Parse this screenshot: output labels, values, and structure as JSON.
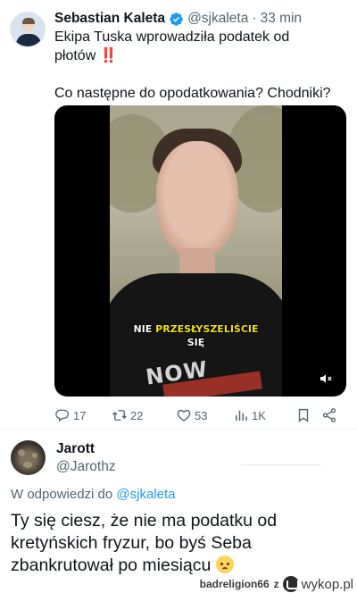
{
  "tweet": {
    "author_name": "Sebastian Kaleta",
    "handle": "@sjkaleta",
    "separator": "·",
    "time": "33 min",
    "text_line1": "Ekipa Tuska wprowadziła podatek od",
    "text_line2": "płotów",
    "text_emoji": "‼️",
    "text_line3": "Co następne do opodatkowania? Chodniki?",
    "video": {
      "caption_word1": "NIE",
      "caption_word2": "PRZESŁYSZELIŚCIE",
      "caption_line2": "SIĘ",
      "shirt_print": "NOW"
    },
    "actions": {
      "replies": "17",
      "retweets": "22",
      "likes": "53",
      "views": "1K"
    }
  },
  "reply": {
    "author_name": "Jarott",
    "handle": "@Jarothz",
    "reply_to_prefix": "W odpowiedzi do",
    "reply_to_handle": "@sjkaleta",
    "text_line1": "Ty się ciesz, że nie ma podatku od",
    "text_line2": "kretyńskich fryzur, bo byś Seba",
    "text_line3": "zbankrutował po miesiącu"
  },
  "watermark": {
    "user": "badreligion66",
    "separator": "z",
    "site": "wykop.pl"
  },
  "colors": {
    "accent": "#1d9bf0",
    "secondary_text": "#536471",
    "caption_yellow": "#f5e400"
  }
}
